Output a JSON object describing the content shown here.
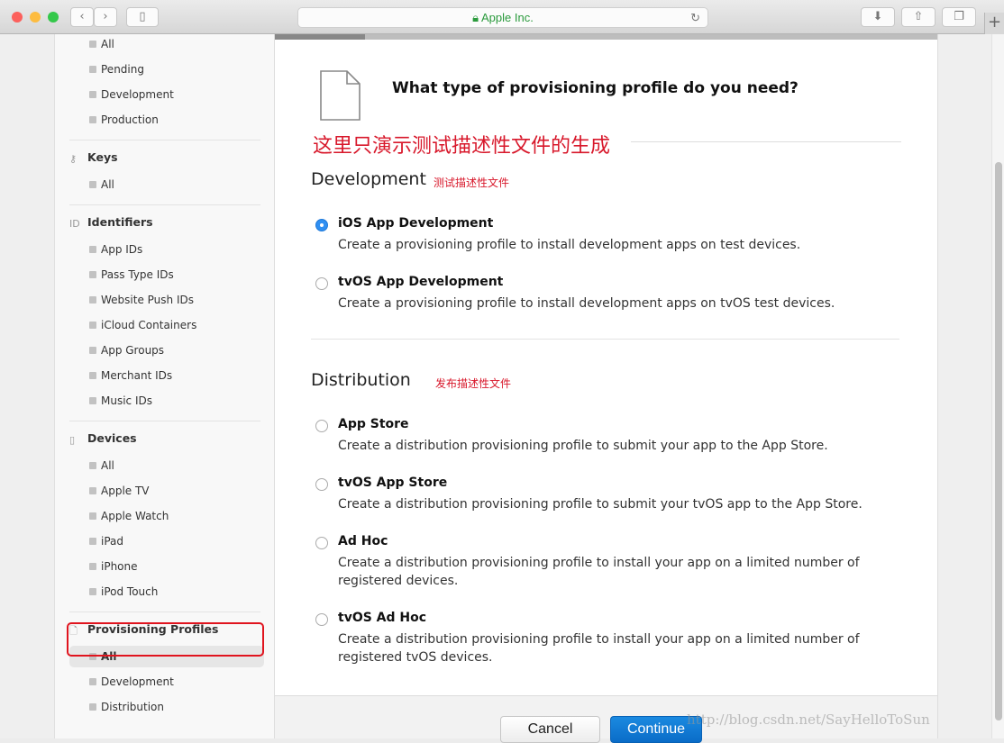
{
  "browser": {
    "address": "Apple Inc.",
    "lock_icon": "lock-icon",
    "reload_icon": "reload-icon",
    "new_tab": "+"
  },
  "sidebar": {
    "groups": [
      {
        "title": "",
        "icon": "",
        "items": [
          "All",
          "Pending",
          "Development",
          "Production"
        ]
      },
      {
        "title": "Keys",
        "icon": "key-icon",
        "items": [
          "All"
        ]
      },
      {
        "title": "Identifiers",
        "icon": "id-icon",
        "items": [
          "App IDs",
          "Pass Type IDs",
          "Website Push IDs",
          "iCloud Containers",
          "App Groups",
          "Merchant IDs",
          "Music IDs"
        ]
      },
      {
        "title": "Devices",
        "icon": "device-icon",
        "items": [
          "All",
          "Apple TV",
          "Apple Watch",
          "iPad",
          "iPhone",
          "iPod Touch"
        ]
      },
      {
        "title": "Provisioning Profiles",
        "icon": "document-icon",
        "items": [
          "All",
          "Development",
          "Distribution"
        ],
        "selected": 0
      }
    ]
  },
  "main": {
    "title": "What type of provisioning profile do you need?",
    "annotation": "这里只演示测试描述性文件的生成",
    "sections": [
      {
        "title": "Development",
        "note": "测试描述性文件",
        "options": [
          {
            "label": "iOS App Development",
            "desc": "Create a provisioning profile to install development apps on test devices.",
            "selected": true
          },
          {
            "label": "tvOS App Development",
            "desc": "Create a provisioning profile to install development apps on tvOS test devices.",
            "selected": false
          }
        ]
      },
      {
        "title": "Distribution",
        "note": "发布描述性文件",
        "options": [
          {
            "label": "App Store",
            "desc": "Create a distribution provisioning profile to submit your app to the App Store.",
            "selected": false
          },
          {
            "label": "tvOS App Store",
            "desc": "Create a distribution provisioning profile to submit your tvOS app to the App Store.",
            "selected": false
          },
          {
            "label": "Ad Hoc",
            "desc": "Create a distribution provisioning profile to install your app on a limited number of registered devices.",
            "selected": false
          },
          {
            "label": "tvOS Ad Hoc",
            "desc": "Create a distribution provisioning profile to install your app on a limited number of registered tvOS devices.",
            "selected": false
          }
        ]
      }
    ],
    "cancel": "Cancel",
    "continue": "Continue"
  },
  "watermark": "http://blog.csdn.net/SayHelloToSun",
  "colors": {
    "accent": "#0a6cc8",
    "annotation": "#d8182b",
    "highlight": "#e0141e"
  }
}
